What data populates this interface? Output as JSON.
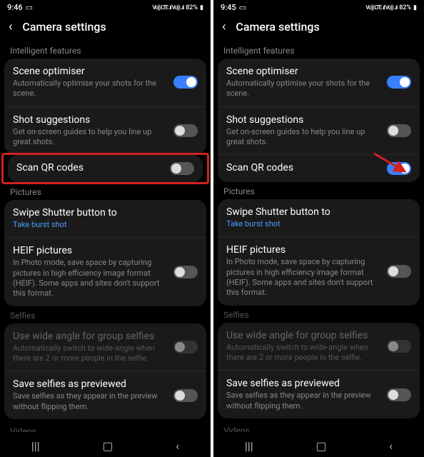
{
  "phones": [
    {
      "status": {
        "time": "9:46",
        "signal": "Vo)) LTE .ıl Vo)) ..ıl",
        "battery": "82%"
      },
      "header": {
        "title": "Camera settings"
      },
      "scanQrToggle": "off",
      "highlightQr": true,
      "showArrow": false
    },
    {
      "status": {
        "time": "9:45",
        "signal": "Vo)) LTE .ıl Vo)) ..ıl",
        "battery": "82%"
      },
      "header": {
        "title": "Camera settings"
      },
      "scanQrToggle": "on",
      "highlightQr": false,
      "showArrow": true
    }
  ],
  "sections": {
    "intelligent": {
      "label": "Intelligent features",
      "sceneOptimiser": {
        "title": "Scene optimiser",
        "subtitle": "Automatically optimise your shots for the scene.",
        "toggle": "on"
      },
      "shotSuggestions": {
        "title": "Shot suggestions",
        "subtitle": "Get on-screen guides to help you line up great shots.",
        "toggle": "off"
      },
      "scanQr": {
        "title": "Scan QR codes"
      }
    },
    "pictures": {
      "label": "Pictures",
      "swipeShutter": {
        "title": "Swipe Shutter button to",
        "subtitle": "Take burst shot"
      },
      "heif": {
        "title": "HEIF pictures",
        "subtitle": "In Photo mode, save space by capturing pictures in high efficiency image format (HEIF). Some apps and sites don't support this format.",
        "toggle": "off"
      }
    },
    "selfies": {
      "label": "Selfies",
      "wideAngle": {
        "title": "Use wide angle for group selfies",
        "subtitle": "Automatically switch to wide-angle when there are 2 or more people in the selfie.",
        "toggle": "off",
        "disabled": true
      },
      "savePreview": {
        "title": "Save selfies as previewed",
        "subtitle": "Save selfies as they appear in the preview without flipping them.",
        "toggle": "off"
      }
    },
    "videos": {
      "label": "Videos"
    }
  },
  "arrow": {
    "color": "#d32020"
  }
}
